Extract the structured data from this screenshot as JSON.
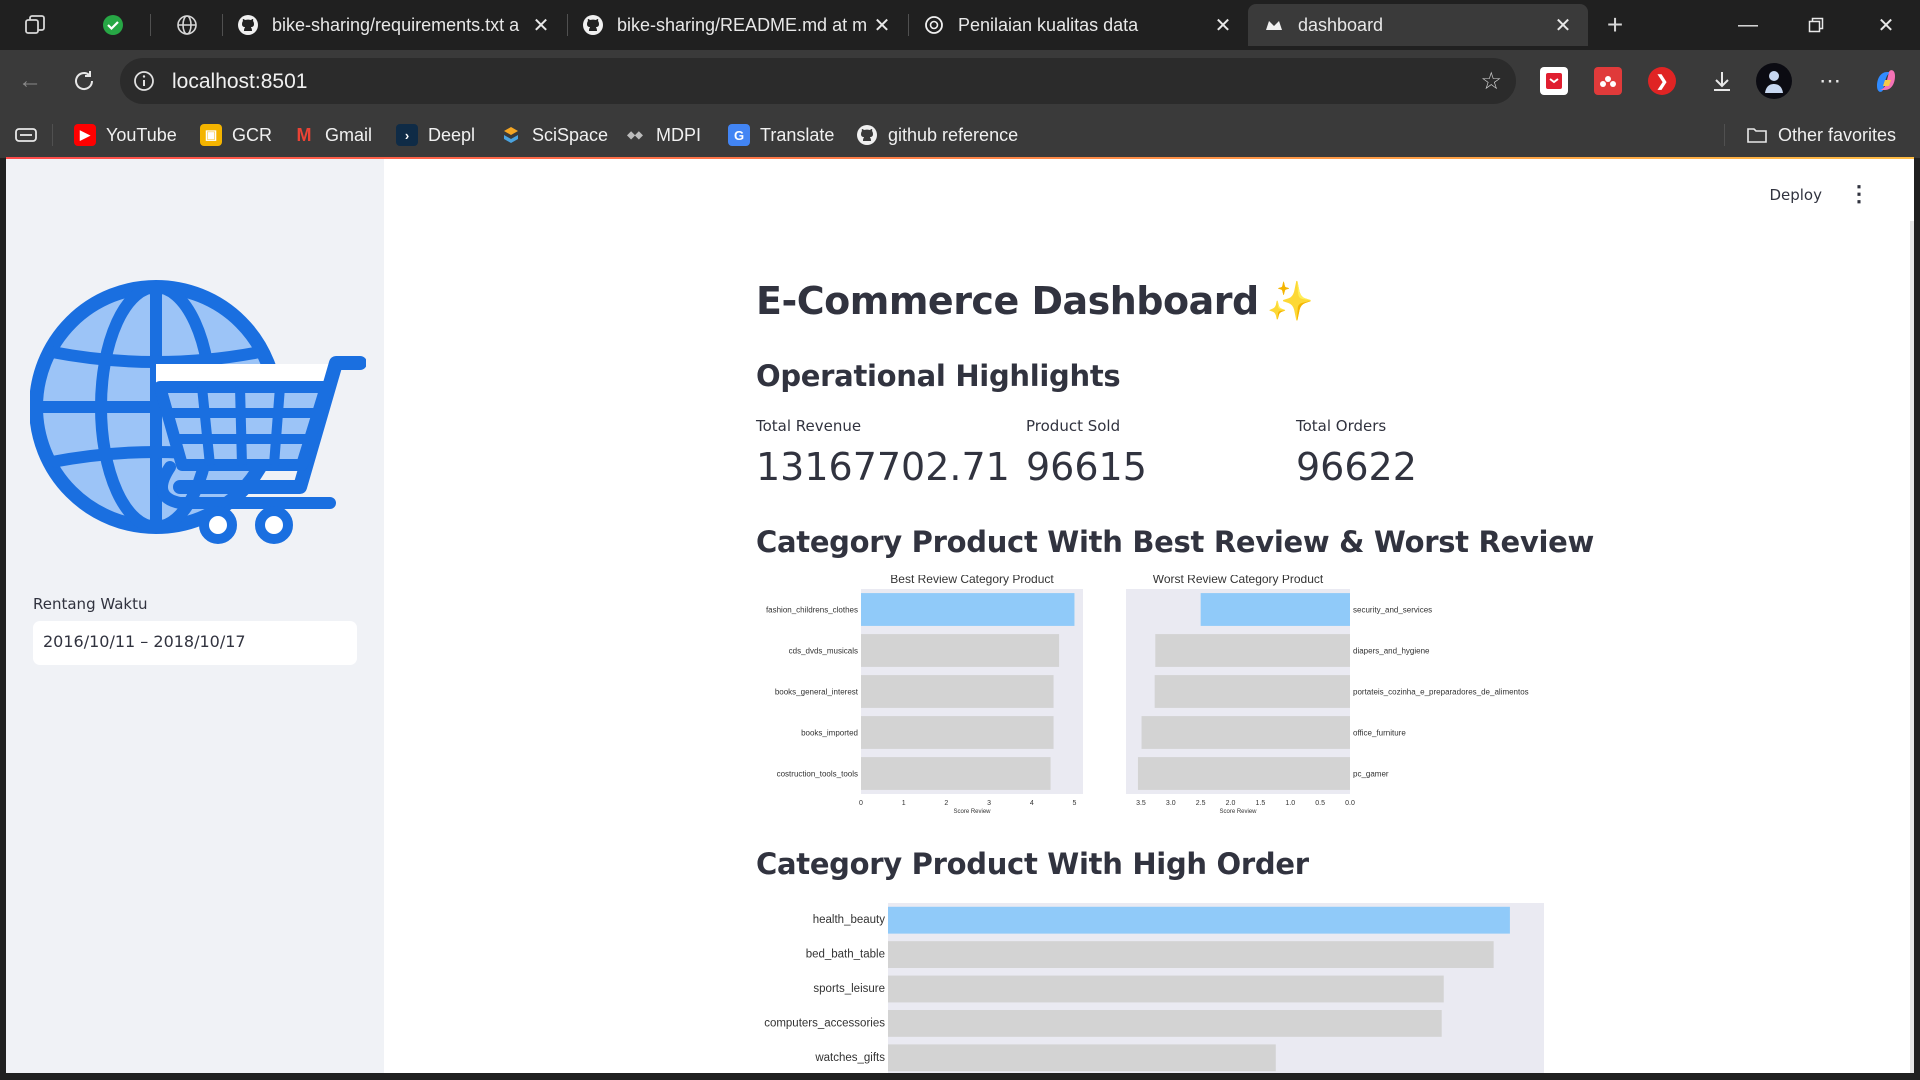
{
  "browser": {
    "tabs": [
      {
        "title": "bike-sharing/requirements.txt a",
        "icon": "github-icon"
      },
      {
        "title": "bike-sharing/README.md at m",
        "icon": "github-icon"
      },
      {
        "title": "Penilaian kualitas data",
        "icon": "openai-icon"
      },
      {
        "title": "dashboard",
        "icon": "streamlit-icon"
      }
    ],
    "address": "localhost:8501",
    "bookmarks": [
      "YouTube",
      "GCR",
      "Gmail",
      "Deepl",
      "SciSpace",
      "MDPI",
      "Translate",
      "github reference"
    ],
    "other_favorites": "Other favorites"
  },
  "sidebar": {
    "range_label": "Rentang Waktu",
    "range_value": "2016/10/11 – 2018/10/17"
  },
  "header": {
    "deploy": "Deploy"
  },
  "main": {
    "title": "E-Commerce Dashboard",
    "title_emoji": "✨",
    "ops_heading": "Operational Highlights",
    "metrics": [
      {
        "label": "Total Revenue",
        "value": "13167702.71"
      },
      {
        "label": "Product Sold",
        "value": "96615"
      },
      {
        "label": "Total Orders",
        "value": "96622"
      }
    ],
    "review_heading": "Category Product With Best Review & Worst Review",
    "order_heading": "Category Product With High Order"
  },
  "colors": {
    "highlight": "#90caf9",
    "bar": "#d3d3d3",
    "plot_bg": "#eaeaf2",
    "accent": "#1a73e8"
  },
  "chart_data": [
    {
      "type": "bar",
      "orientation": "horizontal",
      "title": "Best Review Category Product",
      "xlabel": "Score Review",
      "ylabel": "",
      "categories": [
        "fashion_childrens_clothes",
        "cds_dvds_musicals",
        "books_general_interest",
        "books_imported",
        "costruction_tools_tools"
      ],
      "values": [
        5.0,
        4.64,
        4.51,
        4.51,
        4.44
      ],
      "xlim": [
        0,
        5.2
      ],
      "xticks": [
        "0",
        "1",
        "2",
        "3",
        "4",
        "5"
      ]
    },
    {
      "type": "bar",
      "orientation": "horizontal",
      "inverted_x": true,
      "title": "Worst Review Category Product",
      "xlabel": "Score Review",
      "ylabel": "",
      "categories": [
        "security_and_services",
        "diapers_and_hygiene",
        "portateis_cozinha_e_preparadores_de_alimentos",
        "office_furniture",
        "pc_gamer"
      ],
      "values": [
        2.5,
        3.26,
        3.27,
        3.49,
        3.55
      ],
      "xlim": [
        3.75,
        0
      ],
      "xticks": [
        "3.5",
        "3.0",
        "2.5",
        "2.0",
        "1.5",
        "1.0",
        "0.5",
        "0.0"
      ]
    },
    {
      "type": "bar",
      "orientation": "horizontal",
      "title": "",
      "xlabel": "",
      "ylabel": "",
      "categories": [
        "health_beauty",
        "bed_bath_table",
        "sports_leisure",
        "computers_accessories",
        "watches_gifts"
      ],
      "values": [
        9670,
        9417,
        8641,
        8609,
        6029
      ],
      "xlim": [
        0,
        10200
      ]
    }
  ]
}
